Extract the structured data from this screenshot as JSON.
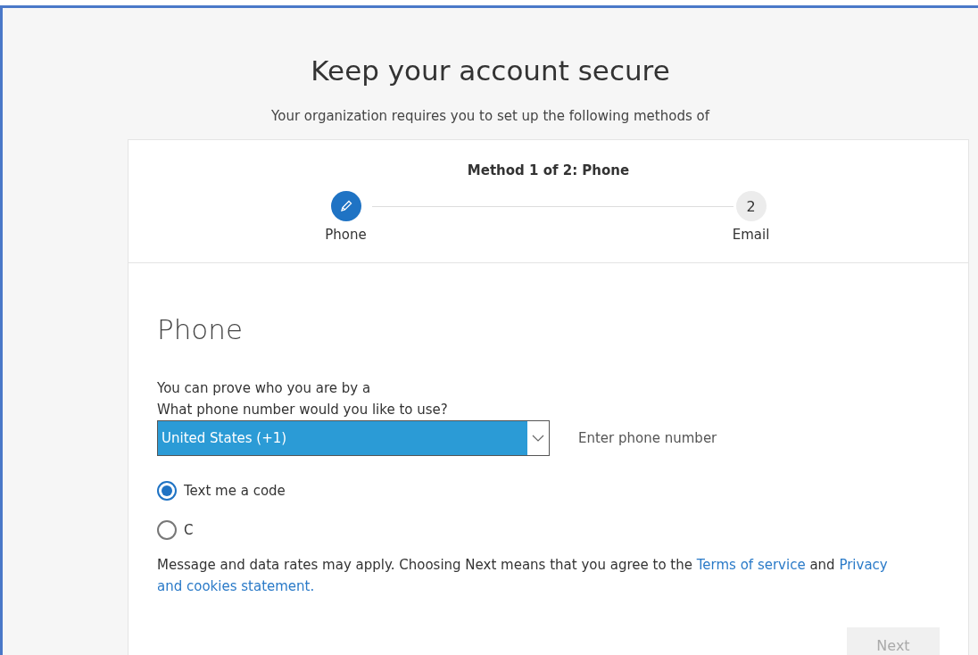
{
  "title": "Keep your account secure",
  "subtitle": "Your organization requires you to set up the following methods of",
  "stepper": {
    "heading": "Method 1 of 2: Phone",
    "steps": [
      {
        "label": "Phone",
        "selected": true
      },
      {
        "label": "Email",
        "marker": "2",
        "selected": false
      }
    ]
  },
  "section": {
    "heading": "Phone",
    "intro": "You can prove who you are by a",
    "question": "What phone number would you like to use?",
    "country": {
      "value": "United States (+1)"
    },
    "phone": {
      "placeholder": "Enter phone number"
    },
    "options": [
      {
        "label": "Text me a code",
        "selected": true
      },
      {
        "label": "C",
        "selected": false
      }
    ],
    "notice": {
      "text": "Message and data rates may apply. Choosing Next means that you agree to the ",
      "terms": "Terms of service",
      "and": " and ",
      "privacy": "Privacy",
      "privacy_rest": "and cookies statement."
    },
    "next": {
      "label": "Next",
      "disabled": true
    }
  }
}
